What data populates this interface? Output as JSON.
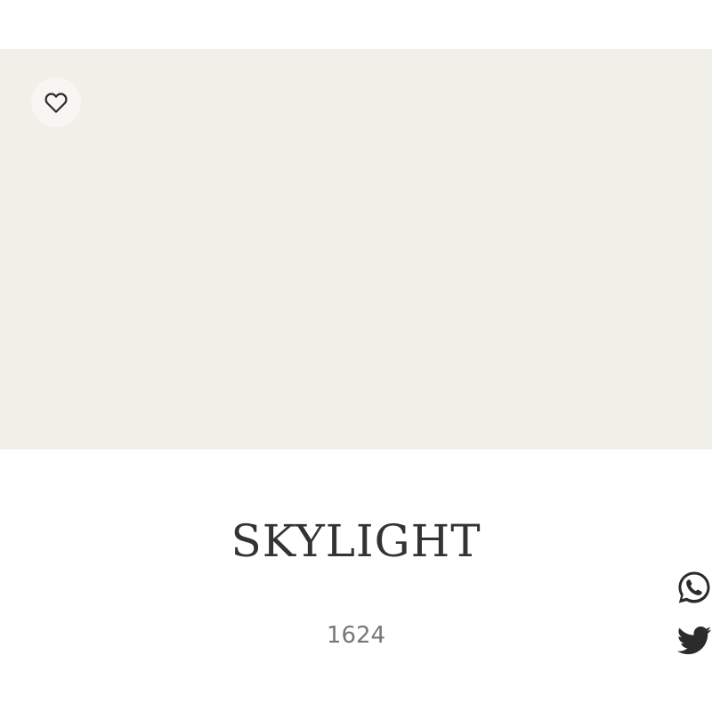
{
  "swatch": {
    "color": "#f0efe8",
    "favorite_icon": "heart-outline-icon"
  },
  "color_name": "SKYLIGHT",
  "color_code": "1624",
  "share": {
    "whatsapp_icon": "whatsapp-icon",
    "twitter_icon": "twitter-icon"
  },
  "colors": {
    "title_text": "#333333",
    "code_text": "#777777",
    "icon": "#2b2b2b"
  }
}
